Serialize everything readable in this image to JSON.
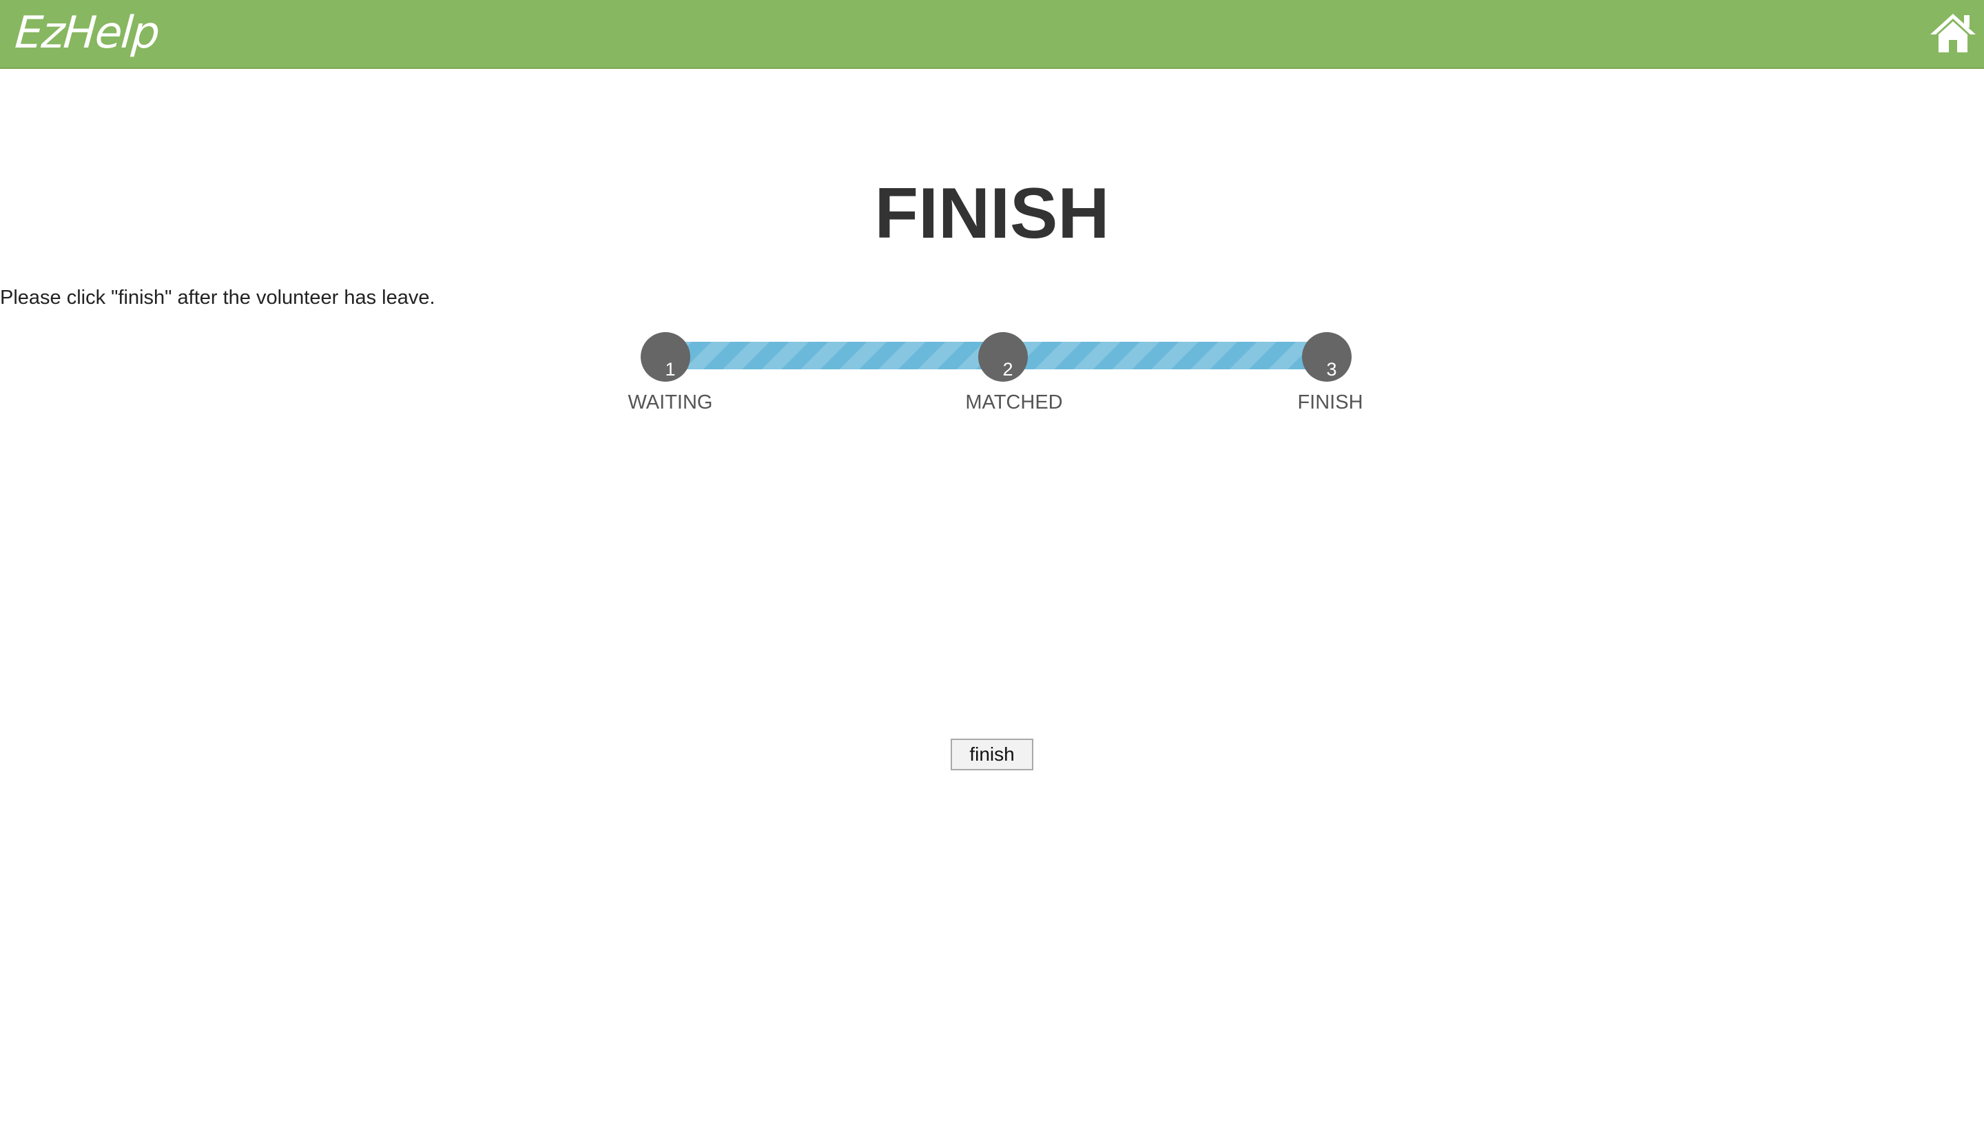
{
  "header": {
    "logo_text": "EzHelp",
    "home_icon": "home-icon",
    "bg_color": "#87b760"
  },
  "page": {
    "title": "FINISH",
    "instruction": "Please click \"finish\" after the volunteer has leave."
  },
  "progress": {
    "track_color": "#6bb9da",
    "dot_color": "#666666",
    "steps": [
      {
        "number": "1",
        "label": "WAITING"
      },
      {
        "number": "2",
        "label": "MATCHED"
      },
      {
        "number": "3",
        "label": "FINISH"
      }
    ]
  },
  "actions": {
    "finish_label": "finish"
  }
}
